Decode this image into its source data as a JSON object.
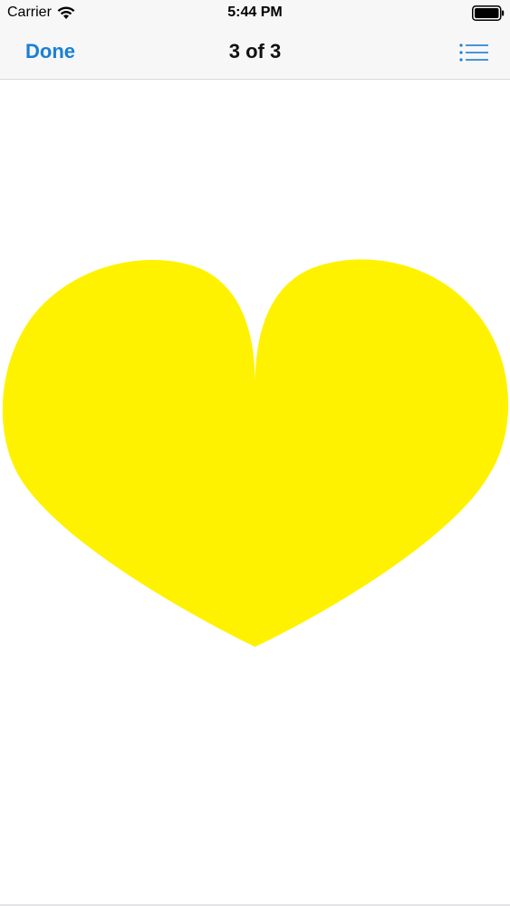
{
  "status_bar": {
    "carrier": "Carrier",
    "time": "5:44 PM",
    "icons": [
      "wifi-icon",
      "battery-icon"
    ]
  },
  "nav_bar": {
    "done_label": "Done",
    "title": "3 of 3",
    "list_icon": "list-icon"
  },
  "content": {
    "shape": "heart",
    "fill_color": "#fff200"
  },
  "colors": {
    "accent": "#1a7fd6",
    "bar_background": "#f7f7f8"
  }
}
